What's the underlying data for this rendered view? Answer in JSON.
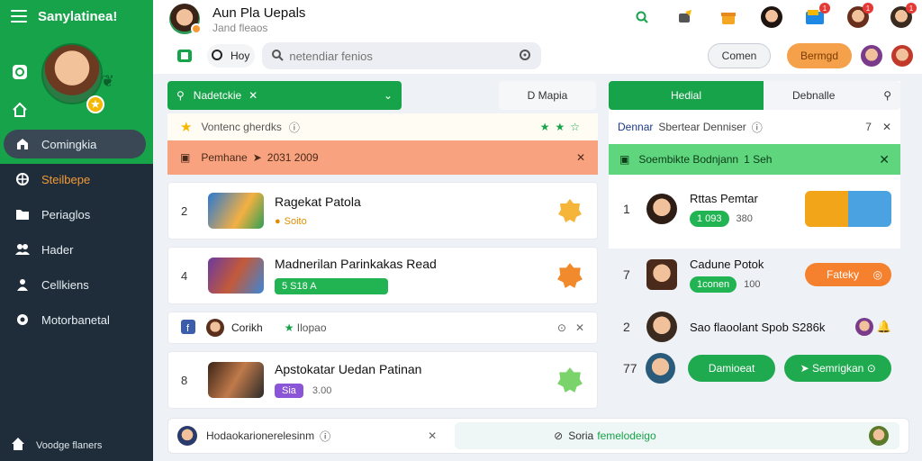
{
  "sidebar": {
    "app_name": "Sanylatinea!",
    "nav": [
      {
        "label": "Comingkia"
      },
      {
        "label": "Steilbepe"
      },
      {
        "label": "Periaglos"
      },
      {
        "label": "Hader"
      },
      {
        "label": "Cellkiens"
      },
      {
        "label": "Motorbanetal"
      }
    ],
    "footer": "Voodge flaners"
  },
  "header": {
    "title": "Aun Pla Uepals",
    "subtitle": "Jand fleaos",
    "location": "Hoy",
    "search_placeholder": "netendiar fenios",
    "notification_counts": [
      "1",
      "1",
      "1"
    ],
    "cancel_label": "Comen",
    "primary_label": "Bermgd"
  },
  "left": {
    "filter_label": "Nadetckie",
    "filter_alt": "D Mapia",
    "info_text": "Vontenc gherdks",
    "promo_text": "Pemhane",
    "promo_value": "2031 2009",
    "cards": [
      {
        "rank": "2",
        "title": "Ragekat Patola",
        "meta": "Soito"
      },
      {
        "rank": "4",
        "title": "Madnerilan Parinkakas Read",
        "meta": "5 S18 A"
      }
    ],
    "contact": {
      "name": "Corikh",
      "tag": "Ilopao"
    },
    "card3": {
      "rank": "8",
      "title": "Apstokatar Uedan Patinan",
      "pill": "Sia",
      "meta": "3.00"
    }
  },
  "right": {
    "tab_active": "Hedial",
    "tab_other": "Debnalle",
    "sub_strong": "Dennar",
    "sub_text": "Sbertear Denniser",
    "sub_count": "7",
    "green_bar": "Soembikte Bodnjann",
    "green_bar_value": "1 Seh",
    "rows": [
      {
        "rank": "1",
        "title": "Rttas Pemtar",
        "pill": "1 093",
        "meta": "380"
      },
      {
        "rank": "7",
        "title": "Cadune Potok",
        "pill": "1conen",
        "meta": "100",
        "button": "Fateky"
      },
      {
        "rank": "2",
        "title": "Sao flaoolant Spob S286k"
      },
      {
        "rank": "77",
        "button1": "Damioeat",
        "button2": "Semrigkan"
      }
    ]
  },
  "bottom": {
    "left_text": "Hodaokarionerelesinm",
    "right_text": "Soria",
    "right_text_green": "femelodeigo"
  },
  "colors": {
    "brand_green": "#17a34a",
    "sidebar_dark": "#1f2d3a",
    "accent_orange": "#f5a14b",
    "promo_salmon": "#f8a27f"
  }
}
